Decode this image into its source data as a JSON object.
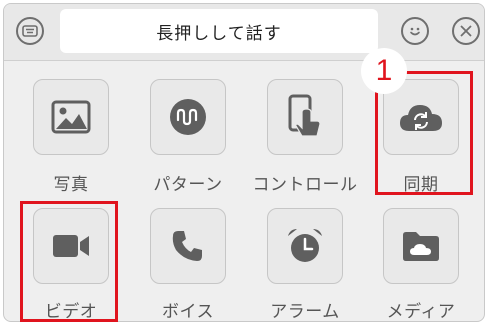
{
  "toolbar": {
    "keyboard_icon": "keyboard-icon",
    "voice_button_label": "長押しして話す",
    "emoji_icon": "smiley-icon",
    "close_icon": "close-icon"
  },
  "tiles": [
    {
      "label": "写真",
      "icon": "image-icon"
    },
    {
      "label": "パターン",
      "icon": "pattern-icon"
    },
    {
      "label": "コントロール",
      "icon": "phone-touch-icon"
    },
    {
      "label": "同期",
      "icon": "cloud-sync-icon"
    },
    {
      "label": "ビデオ",
      "icon": "video-camera-icon"
    },
    {
      "label": "ボイス",
      "icon": "phone-handset-icon"
    },
    {
      "label": "アラーム",
      "icon": "alarm-clock-icon"
    },
    {
      "label": "メディア",
      "icon": "media-folder-icon"
    }
  ],
  "annotation": {
    "step_number": "1",
    "highlight_color": "#e0141e"
  },
  "colors": {
    "icon_gray": "#5f5f5f",
    "tile_bg": "#e9e9e9"
  }
}
